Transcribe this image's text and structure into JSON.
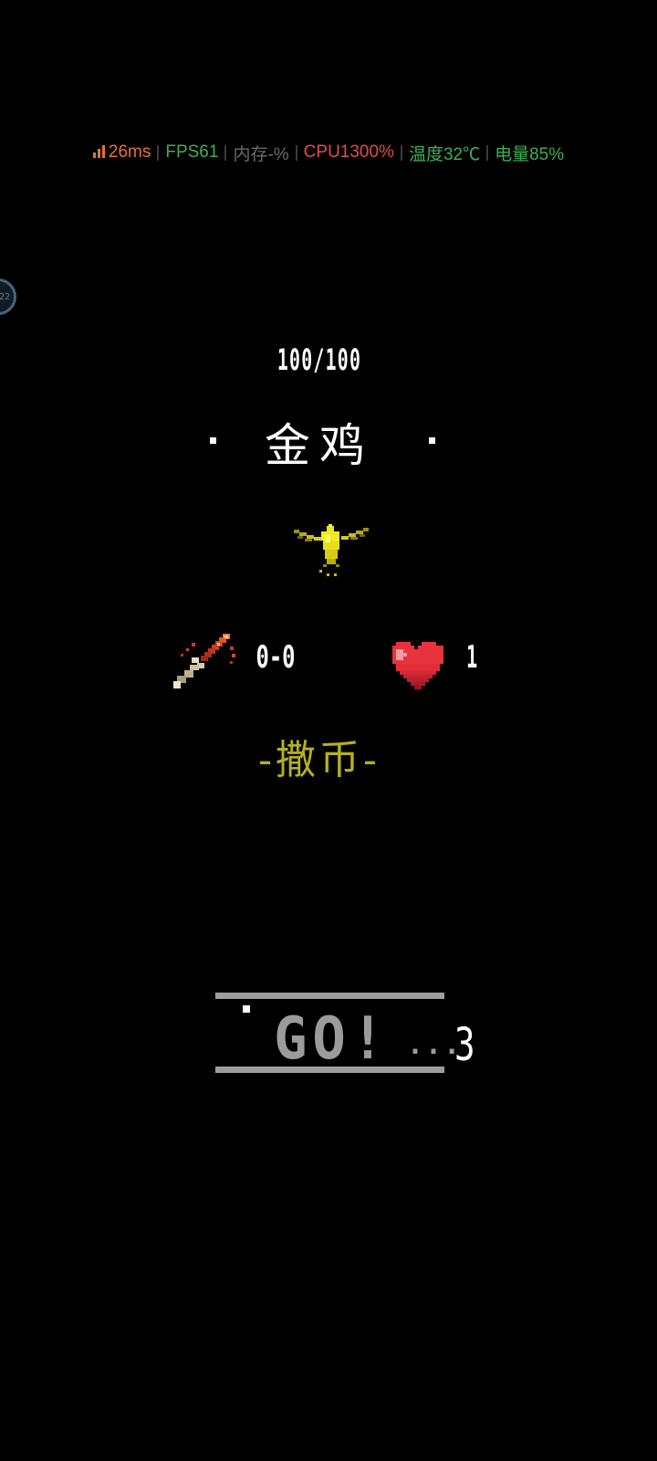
{
  "perf_overlay": {
    "latency": "26ms",
    "fps": "FPS61",
    "memory": "内存-%",
    "cpu": "CPU1300%",
    "temperature": "温度32℃",
    "battery": "电量85%",
    "colors": {
      "latency": "#e8703a",
      "fps": "#3fae54",
      "memory": "#6b6b6b",
      "cpu": "#e24b4b",
      "temperature": "#3fae54",
      "battery": "#3fae54"
    }
  },
  "floating_ball": {
    "label": "22"
  },
  "enemy": {
    "hp": "100/100",
    "name": "金鸡",
    "sprite_icon": "golden-bird-icon"
  },
  "stats": {
    "attack_icon": "sword-icon",
    "attack": "0-0",
    "life_icon": "heart-icon",
    "life": "1"
  },
  "action": {
    "label": "-撒币-",
    "color": "#b5b01f"
  },
  "go_banner": {
    "label": "GO!",
    "ellipsis": "...",
    "countdown": "3"
  }
}
